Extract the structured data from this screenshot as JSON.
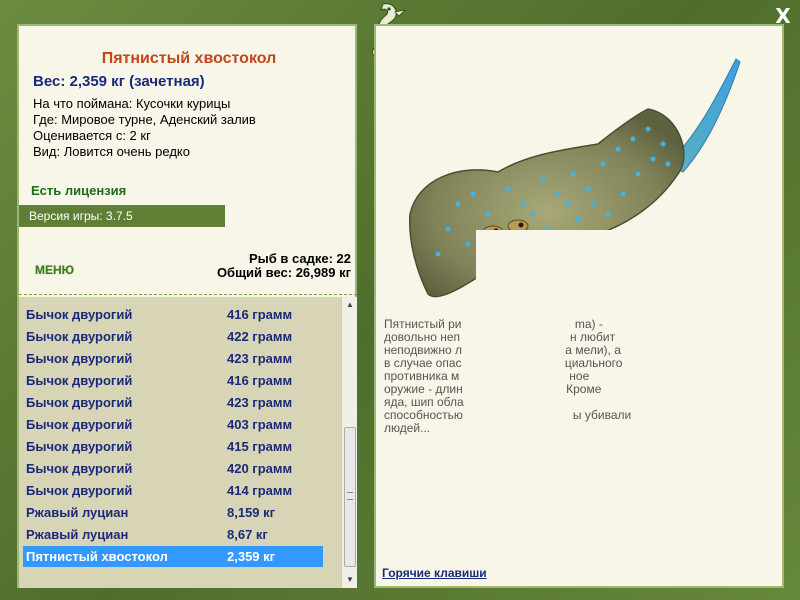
{
  "header": {
    "close_label": "X"
  },
  "fish": {
    "title": "Пятнистый хвостокол",
    "weight": "Вес: 2,359 кг (зачетная)",
    "caught_on": "На что поймана: Кусочки курицы",
    "location": "Где: Мировое турне, Аденский залив",
    "rated_from": "Оценивается с: 2 кг",
    "rarity": "Вид: Ловится очень редко"
  },
  "license": "Есть лицензия",
  "version": "Версия игры: 3.7.5",
  "menu_label": "МЕНЮ",
  "stats": {
    "fish_in_keepnet": "Рыб в садке: 22",
    "total_weight": "Общий вес: 26,989 кг"
  },
  "catch_list": [
    {
      "name": "Бычок двурогий",
      "weight": "416 грамм"
    },
    {
      "name": "Бычок двурогий",
      "weight": "422 грамм"
    },
    {
      "name": "Бычок двурогий",
      "weight": "423 грамм"
    },
    {
      "name": "Бычок двурогий",
      "weight": "416 грамм"
    },
    {
      "name": "Бычок двурогий",
      "weight": "423 грамм"
    },
    {
      "name": "Бычок двурогий",
      "weight": "403 грамм"
    },
    {
      "name": "Бычок двурогий",
      "weight": "415 грамм"
    },
    {
      "name": "Бычок двурогий",
      "weight": "420 грамм"
    },
    {
      "name": "Бычок двурогий",
      "weight": "414 грамм"
    },
    {
      "name": "Ржавый луциан",
      "weight": "8,159 кг"
    },
    {
      "name": "Ржавый луциан",
      "weight": "8,67 кг"
    },
    {
      "name": "Пятнистый хвостокол",
      "weight": "2,359 кг",
      "selected": true
    }
  ],
  "description": {
    "lines": [
      "Пятнистый ри                                  ma) -",
      "довольно неп                                 н любит",
      "неподвижно л                               а мели), а",
      "в случае опас                               циального",
      "противника м                                 ное",
      "оружие - длин                               Кроме",
      "яда, шип обла",
      "способностью                                 ы убивали",
      "людей..."
    ]
  },
  "hotkeys_label": "Горячие клавиши",
  "colors": {
    "frame": "#5a7a36",
    "panel": "#f7f6e8",
    "list_bg": "#d7d5b5",
    "title": "#c0461b",
    "text_blue": "#1a2a7a",
    "selection": "#3399ff"
  },
  "icons": {
    "logo": "seahorse-logo",
    "close": "close-icon",
    "scroll_up": "chevron-up-icon",
    "scroll_down": "chevron-down-icon"
  }
}
